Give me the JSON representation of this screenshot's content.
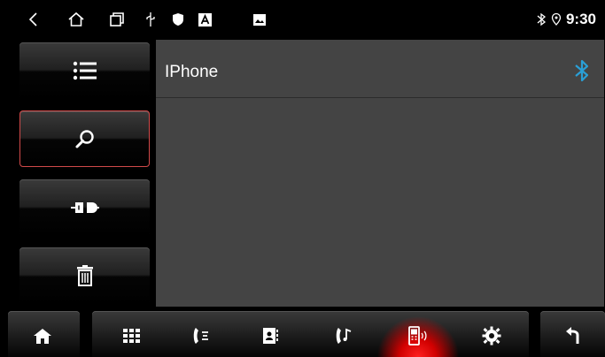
{
  "status_bar": {
    "time": "9:30",
    "icons": [
      "back-nav-icon",
      "home-nav-icon",
      "recent-apps-icon",
      "usb-icon",
      "shield-icon",
      "a-box-icon",
      "image-icon",
      "bluetooth-icon",
      "location-icon"
    ]
  },
  "side_menu": {
    "items": [
      {
        "name": "list-menu-button",
        "icon": "list-icon",
        "active": false
      },
      {
        "name": "search-button",
        "icon": "search-icon",
        "active": true
      },
      {
        "name": "connect-button",
        "icon": "plug-connect-icon",
        "active": false
      },
      {
        "name": "delete-button",
        "icon": "trash-icon",
        "active": false
      }
    ]
  },
  "device_list": {
    "devices": [
      {
        "name": "IPhone",
        "icon": "bluetooth-icon"
      }
    ]
  },
  "dock": {
    "items": [
      "home-icon",
      "dialpad-icon",
      "call-log-icon",
      "contacts-icon",
      "phone-music-icon",
      "phone-link-icon",
      "settings-icon",
      "return-icon"
    ],
    "active": "phone-link-icon",
    "accent": "#ff2020"
  },
  "colors": {
    "panel_bg": "#444444",
    "active_border": "#d24a4a",
    "bluetooth": "#2a9fd6"
  }
}
